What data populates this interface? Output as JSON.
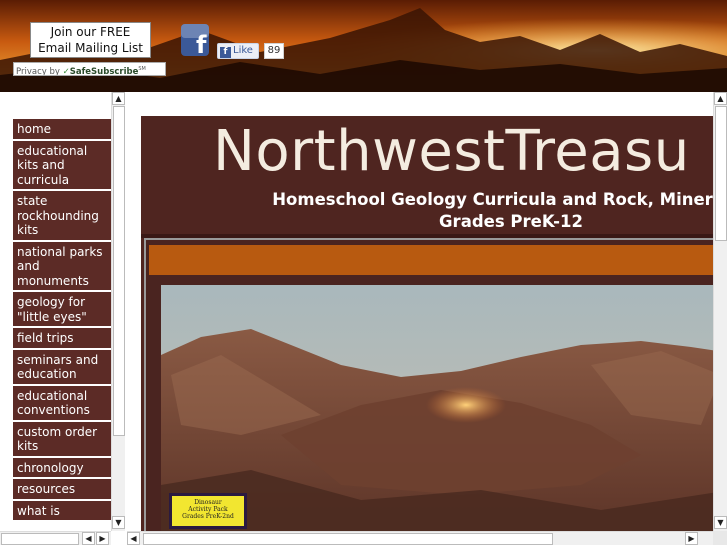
{
  "header": {
    "signup_line1": "Join our FREE",
    "signup_line2": "Email Mailing List",
    "privacy_by": "Privacy by",
    "safesubscribe": "SafeSubscribe",
    "safesubscribe_mark": "SM",
    "facebook_icon": "facebook-icon",
    "like_label": "Like",
    "like_count": "89"
  },
  "nav": {
    "items": [
      "home",
      "educational kits and curricula",
      "state rockhounding kits",
      "national parks and monuments",
      "geology for \"little eyes\"",
      "field trips",
      "seminars and education",
      "educational conventions",
      "custom order kits",
      "chronology",
      "resources",
      "what is"
    ]
  },
  "main": {
    "site_title": "NorthwestTreasu",
    "tagline_line1": "Homeschool Geology Curricula and Rock, Mineral &",
    "tagline_line2": "Grades PreK-12",
    "book_line1": "Dinosaur",
    "book_line2": "Activity Pack",
    "book_line3": "Grades PreK-2nd"
  },
  "colors": {
    "nav_bg": "#5c2b26",
    "content_bg": "#4f2520",
    "accent_bar": "#b85a10",
    "facebook_blue": "#3b5998"
  }
}
